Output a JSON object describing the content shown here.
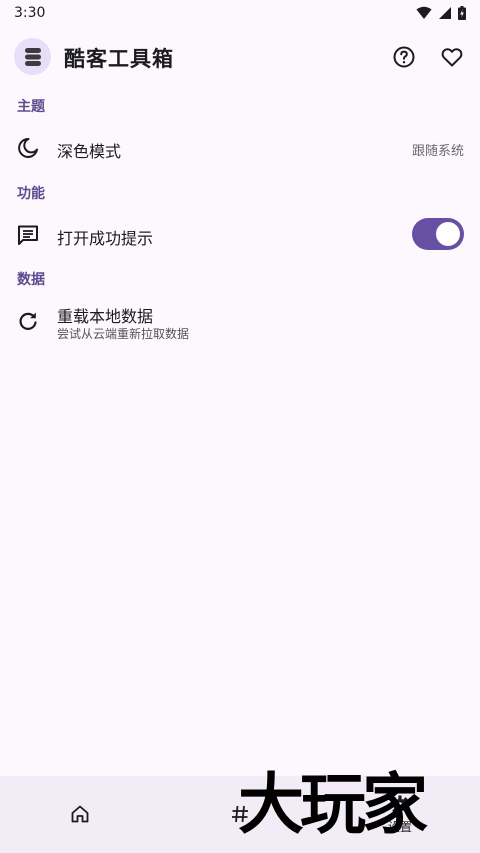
{
  "status": {
    "time": "3:30"
  },
  "app": {
    "title": "酷客工具箱"
  },
  "sections": {
    "theme": {
      "title": "主题",
      "dark_mode": {
        "label": "深色模式",
        "value": "跟随系统"
      }
    },
    "function": {
      "title": "功能",
      "open_tip": {
        "label": "打开成功提示",
        "enabled": true
      }
    },
    "data": {
      "title": "数据",
      "reload": {
        "label": "重载本地数据",
        "subtitle": "尝试从云端重新拉取数据"
      }
    }
  },
  "bottom_nav": {
    "items": [
      {
        "icon": "home-icon",
        "label": ""
      },
      {
        "icon": "hash-icon",
        "label": ""
      },
      {
        "icon": "gear-icon",
        "label": "设置"
      }
    ]
  },
  "watermark": {
    "text": "大玩家"
  },
  "colors": {
    "accent": "#6750a4",
    "section": "#5e4b8f",
    "background": "#fdf8fd",
    "nav": "#f2ecf7"
  }
}
